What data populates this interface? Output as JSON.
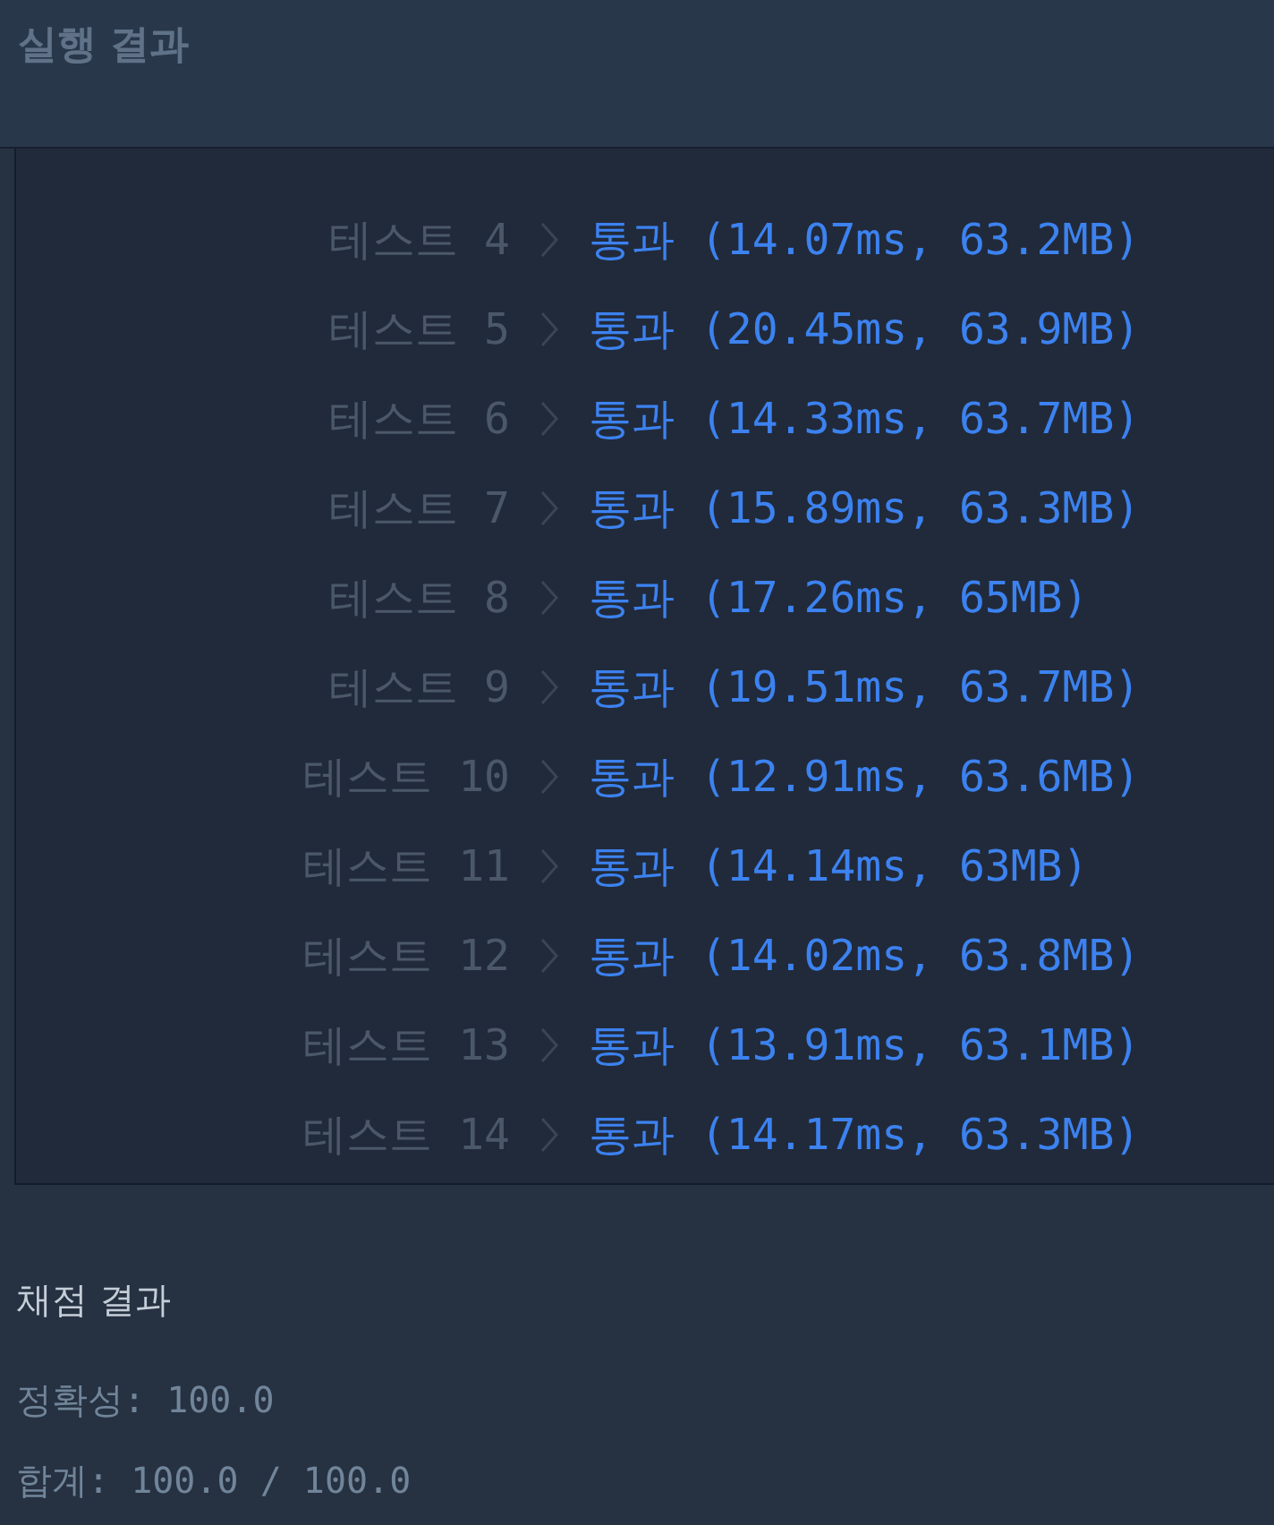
{
  "header": {
    "title": "실행 결과"
  },
  "tests": [
    {
      "label": "테스트 4",
      "result": "통과",
      "detail": "(14.07ms, 63.2MB)"
    },
    {
      "label": "테스트 5",
      "result": "통과",
      "detail": "(20.45ms, 63.9MB)"
    },
    {
      "label": "테스트 6",
      "result": "통과",
      "detail": "(14.33ms, 63.7MB)"
    },
    {
      "label": "테스트 7",
      "result": "통과",
      "detail": "(15.89ms, 63.3MB)"
    },
    {
      "label": "테스트 8",
      "result": "통과",
      "detail": "(17.26ms, 65MB)"
    },
    {
      "label": "테스트 9",
      "result": "통과",
      "detail": "(19.51ms, 63.7MB)"
    },
    {
      "label": "테스트 10",
      "result": "통과",
      "detail": "(12.91ms, 63.6MB)"
    },
    {
      "label": "테스트 11",
      "result": "통과",
      "detail": "(14.14ms, 63MB)"
    },
    {
      "label": "테스트 12",
      "result": "통과",
      "detail": "(14.02ms, 63.8MB)"
    },
    {
      "label": "테스트 13",
      "result": "통과",
      "detail": "(13.91ms, 63.1MB)"
    },
    {
      "label": "테스트 14",
      "result": "통과",
      "detail": "(14.17ms, 63.3MB)"
    }
  ],
  "summary": {
    "title": "채점 결과",
    "lines": [
      {
        "label": "정확성:",
        "value": "100.0"
      },
      {
        "label": "합계:",
        "value": "100.0 / 100.0"
      }
    ]
  }
}
